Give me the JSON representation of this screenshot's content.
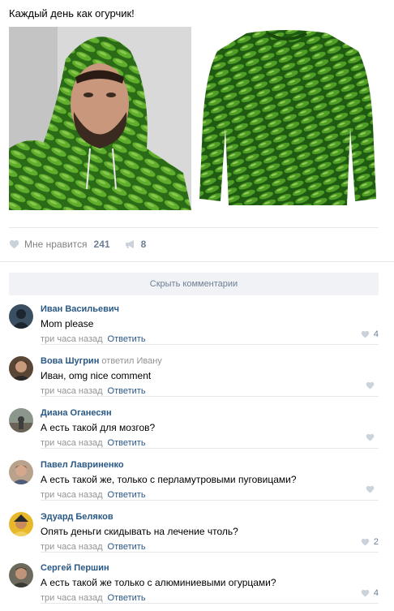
{
  "post": {
    "text": "Каждый день как огурчик!"
  },
  "actions": {
    "like_label": "Мне нравится",
    "like_count": "241",
    "repost_count": "8"
  },
  "hide_comments_label": "Скрыть комментарии",
  "colors": {
    "link": "#2a5885",
    "muted": "#939393",
    "like_icon": "#cad2db",
    "pickle_dark": "#1f5a12",
    "pickle_light": "#5fae2c"
  },
  "comments": [
    {
      "author": "Иван Васильевич",
      "answered": "",
      "text": "Mom please",
      "time": "три часа назад",
      "reply": "Ответить",
      "likes": "4",
      "avatar_color": "#33485c"
    },
    {
      "author": "Вова Шугрин",
      "answered": "ответил Ивану",
      "text": "Иван, omg nice comment",
      "time": "три часа назад",
      "reply": "Ответить",
      "likes": "",
      "avatar_color": "#4a3a2c"
    },
    {
      "author": "Диана Оганесян",
      "answered": "",
      "text": "А есть такой для мозгов?",
      "time": "три часа назад",
      "reply": "Ответить",
      "likes": "",
      "avatar_color": "#6f7f6a"
    },
    {
      "author": "Павел Лавриненко",
      "answered": "",
      "text": "А есть такой же, только с перламутровыми пуговицами?",
      "time": "три часа назад",
      "reply": "Ответить",
      "likes": "",
      "avatar_color": "#7a5a44"
    },
    {
      "author": "Эдуард Беляков",
      "answered": "",
      "text": "Опять деньги скидывать на лечение чтоль?",
      "time": "три часа назад",
      "reply": "Ответить",
      "likes": "2",
      "avatar_color": "#d4a21c"
    },
    {
      "author": "Сергей Першин",
      "answered": "",
      "text": "А есть такой же только с алюминиевыми огурцами?",
      "time": "три часа назад",
      "reply": "Ответить",
      "likes": "4",
      "avatar_color": "#5b5a4e"
    }
  ]
}
